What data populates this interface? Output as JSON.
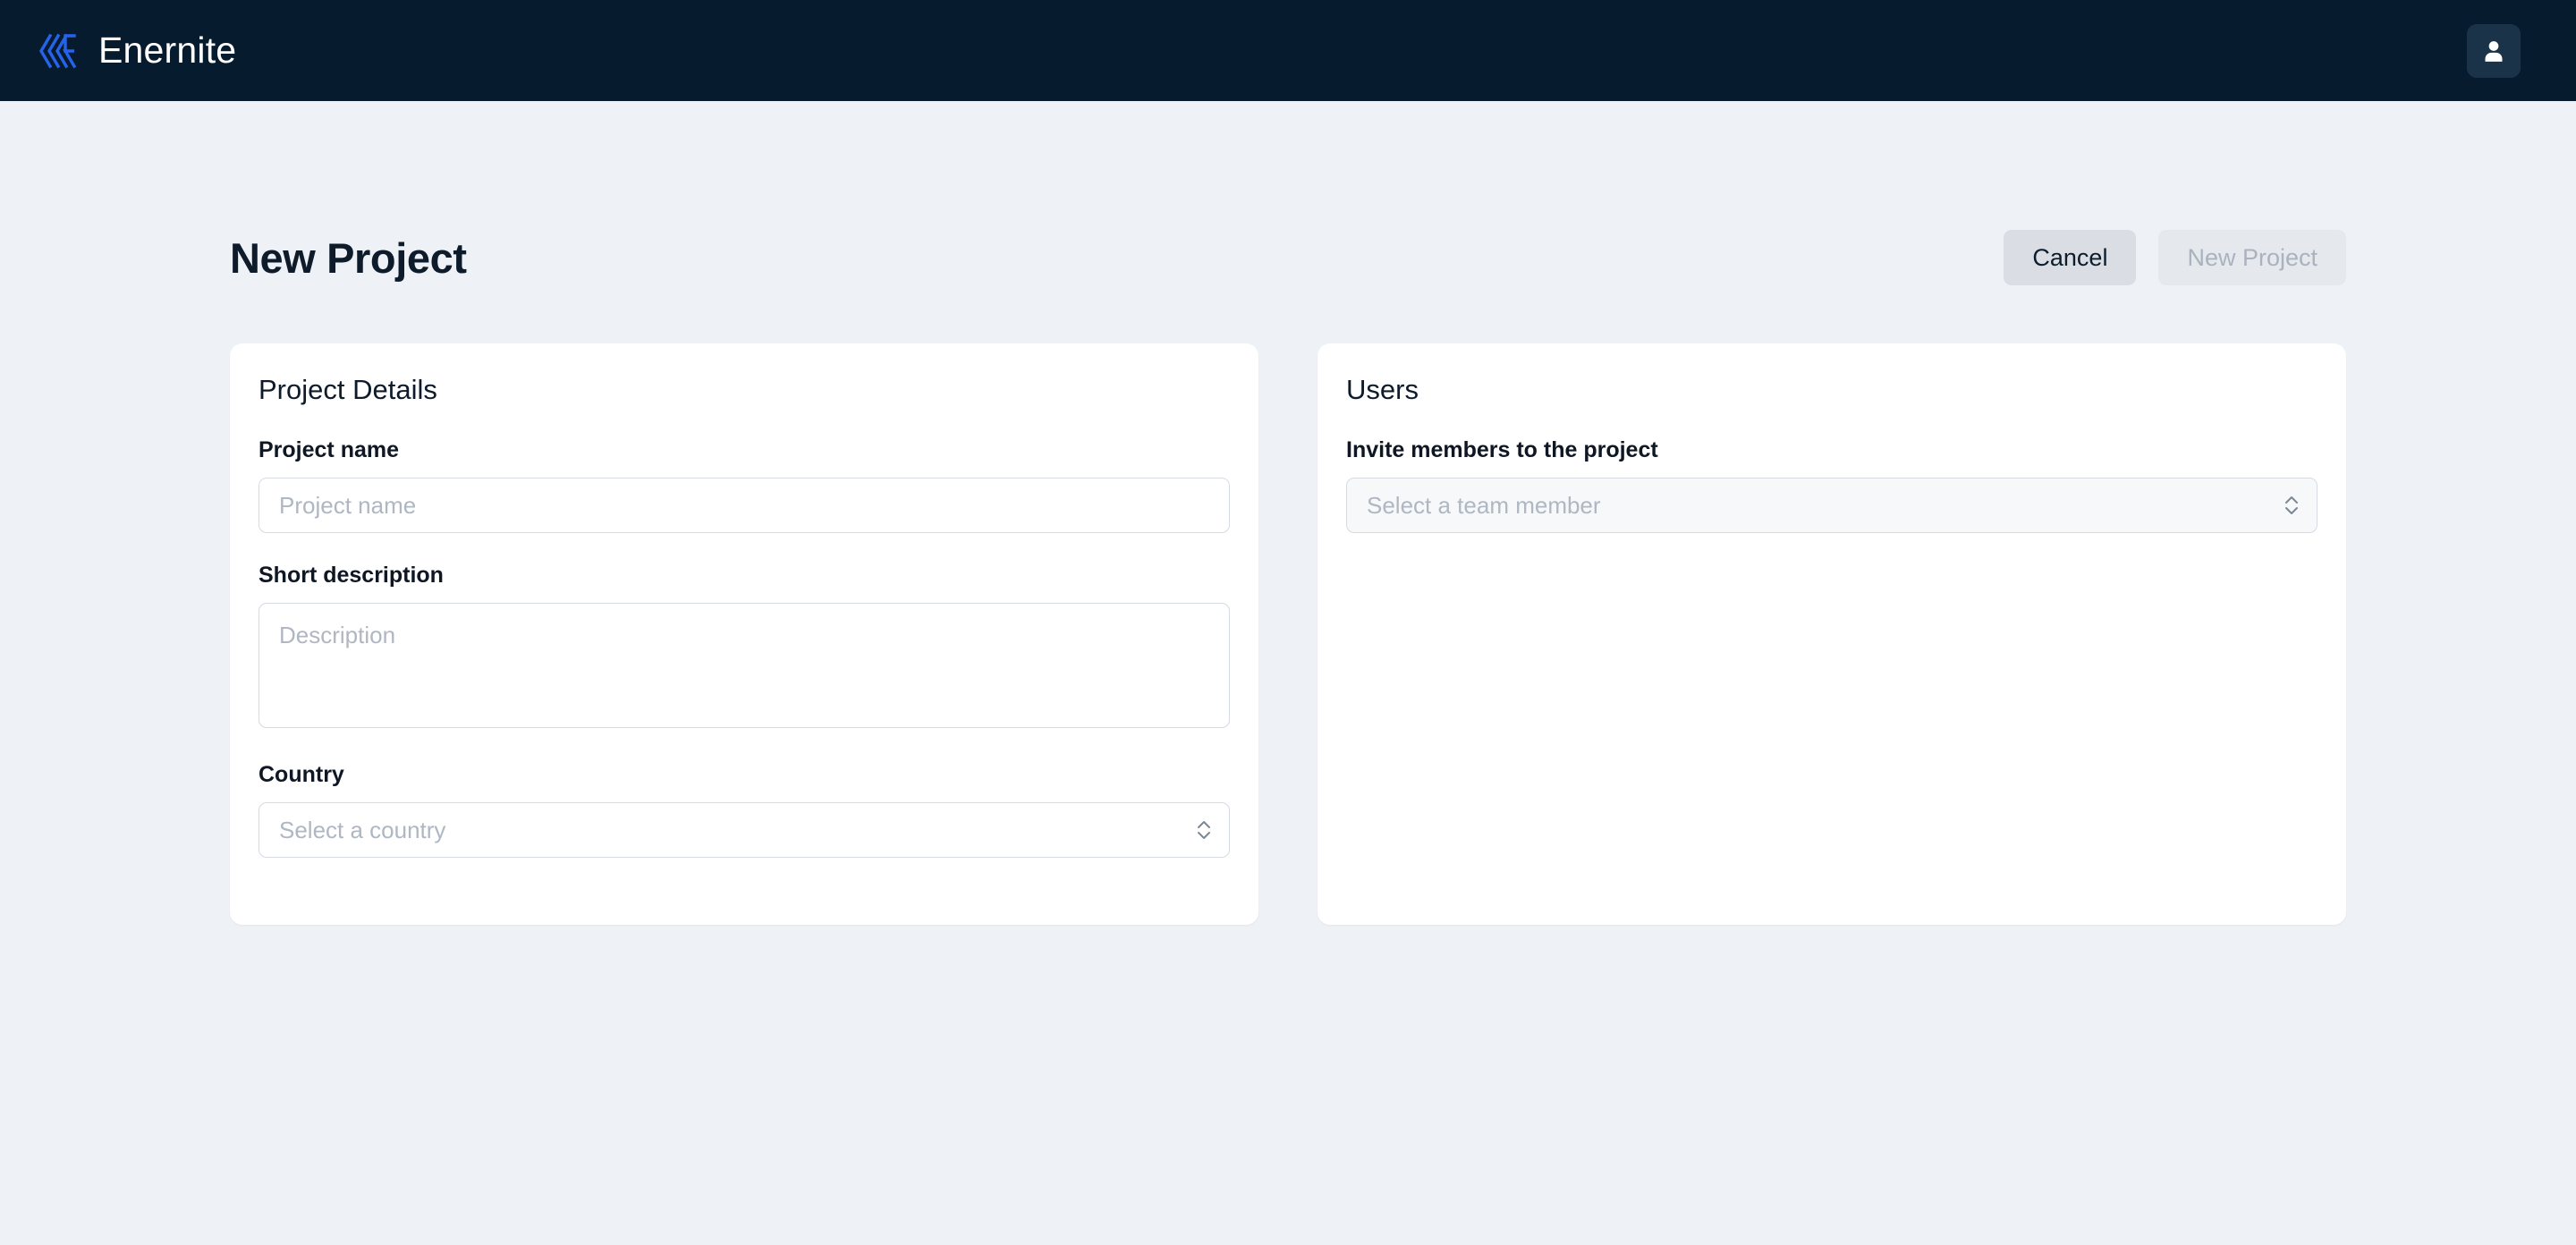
{
  "topbar": {
    "brand_name": "Enernite",
    "logo_icon": "enernite-logo-icon",
    "avatar_icon": "user-icon"
  },
  "page": {
    "title": "New Project",
    "actions": {
      "cancel_label": "Cancel",
      "submit_label": "New Project"
    }
  },
  "project_details_card": {
    "title": "Project Details",
    "fields": {
      "project_name": {
        "label": "Project name",
        "placeholder": "Project name",
        "value": ""
      },
      "short_description": {
        "label": "Short description",
        "placeholder": "Description",
        "value": ""
      },
      "country": {
        "label": "Country",
        "placeholder": "Select a country",
        "value": "Select a country"
      }
    }
  },
  "users_card": {
    "title": "Users",
    "fields": {
      "invite_members": {
        "label": "Invite members to the project",
        "placeholder": "Select a team member",
        "value": "Select a team member"
      }
    }
  },
  "colors": {
    "topbar_bg": "#071b2e",
    "page_bg": "#eef1f5",
    "card_bg": "#ffffff",
    "brand_blue": "#2563eb",
    "text_dark": "#0d1b2b",
    "placeholder": "#aeb7c2",
    "border": "#d6dbe2",
    "btn_secondary_bg": "#dadee4",
    "btn_disabled_bg": "#e5e9ee",
    "btn_disabled_text": "#aab2bd"
  }
}
